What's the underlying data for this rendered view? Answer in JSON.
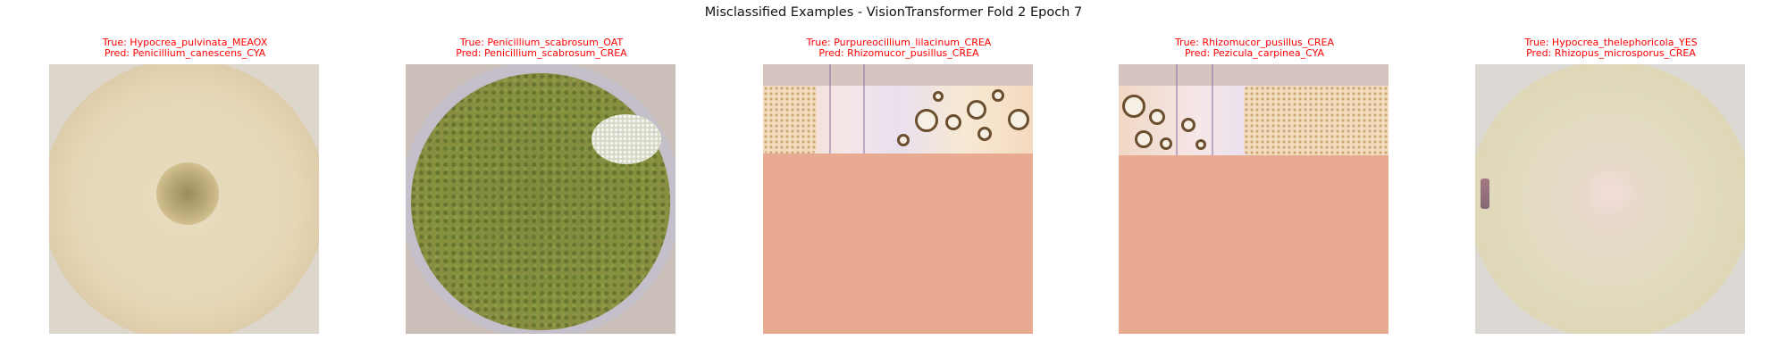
{
  "figure": {
    "title": "Misclassified Examples - VisionTransformer Fold 2 Epoch 7"
  },
  "panels": [
    {
      "true_label": "True: Hypocrea_pulvinata_MEAOX",
      "pred_label": "Pred: Penicillium_canescens_CYA"
    },
    {
      "true_label": "True: Penicillium_scabrosum_OAT",
      "pred_label": "Pred: Penicillium_scabrosum_CREA"
    },
    {
      "true_label": "True: Purpureocillium_lilacinum_CREA",
      "pred_label": "Pred: Rhizomucor_pusillus_CREA"
    },
    {
      "true_label": "True: Rhizomucor_pusillus_CREA",
      "pred_label": "Pred: Pezicula_carpinea_CYA"
    },
    {
      "true_label": "True: Hypocrea_thelephoricola_YES",
      "pred_label": "Pred: Rhizopus_microsporus_CREA"
    }
  ],
  "colors": {
    "caption": "#ff0000",
    "title": "#111111"
  }
}
